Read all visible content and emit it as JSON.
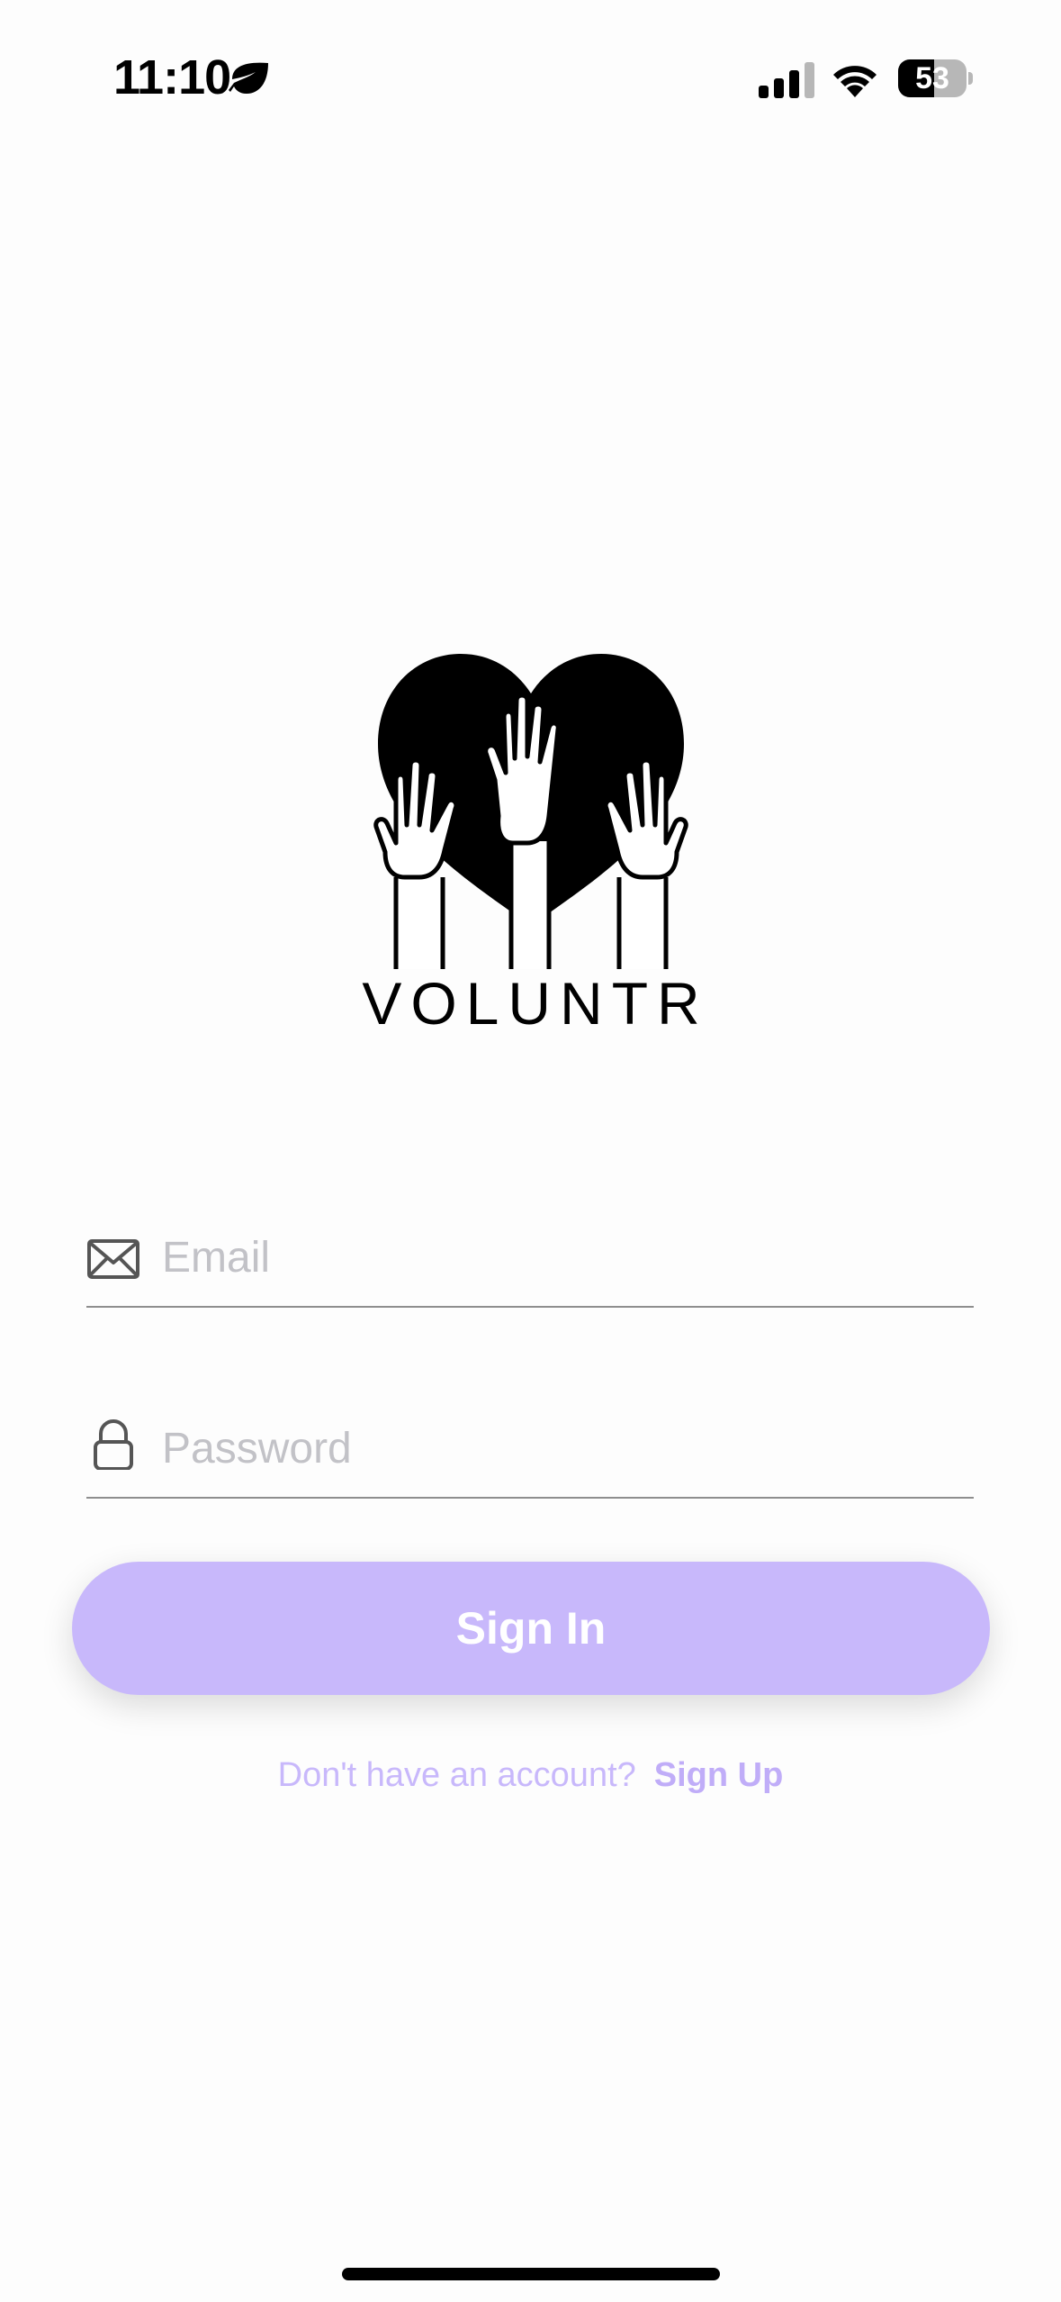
{
  "status_bar": {
    "time": "11:10",
    "battery_percent": "53",
    "battery_level": 0.53,
    "focus_icon": "leaf-icon",
    "signal_icon": "cellular-signal-icon",
    "wifi_icon": "wifi-icon"
  },
  "logo": {
    "wordmark": "VOLUNTR",
    "icon": "heart-with-raised-hands-icon"
  },
  "form": {
    "email": {
      "placeholder": "Email",
      "value": "",
      "icon": "envelope-icon"
    },
    "password": {
      "placeholder": "Password",
      "value": "",
      "icon": "lock-icon"
    },
    "submit_label": "Sign In"
  },
  "footer": {
    "prompt": "Don't have an account?",
    "link_label": "Sign Up"
  },
  "colors": {
    "accent": "#c8b8fb",
    "background": "#fdfdfd",
    "placeholder": "#c2c2c7"
  }
}
